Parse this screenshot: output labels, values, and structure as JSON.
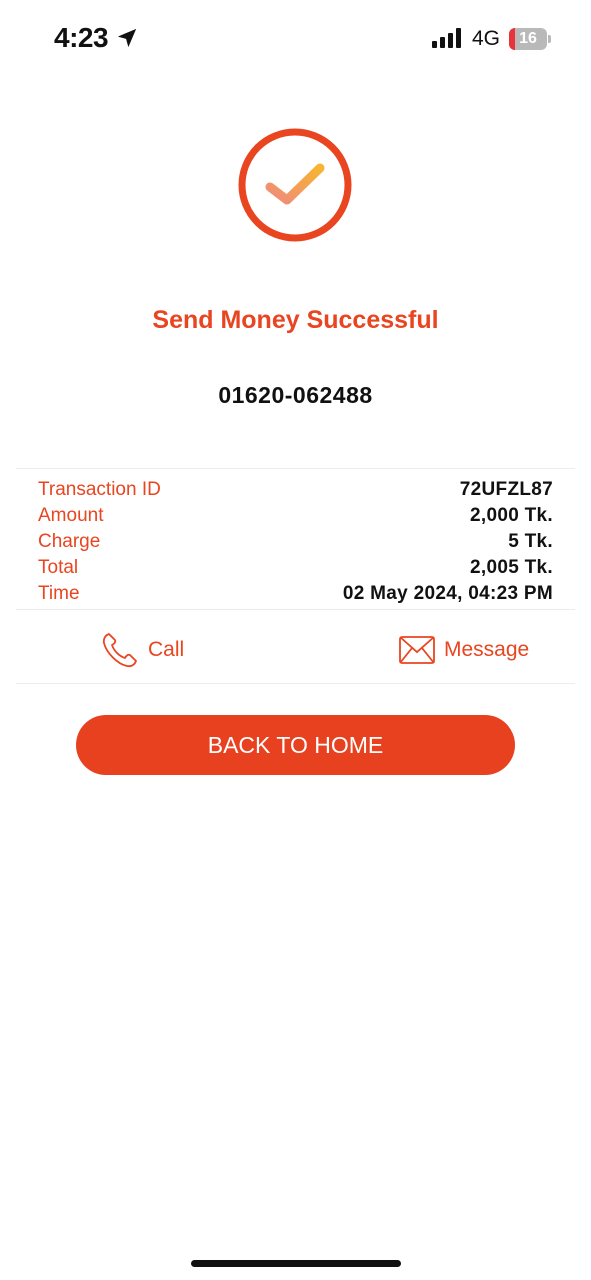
{
  "status_bar": {
    "time": "4:23",
    "network": "4G",
    "battery_level": "16",
    "battery_fraction": 0.16,
    "icons": [
      "location-arrow-icon",
      "signal-bars-icon",
      "battery-icon"
    ]
  },
  "success": {
    "icon": "checkmark-circle-icon",
    "title": "Send Money Successful",
    "recipient": "01620-062488"
  },
  "details": [
    {
      "label": "Transaction ID",
      "value": "72UFZL87"
    },
    {
      "label": "Amount",
      "value": "2,000 Tk."
    },
    {
      "label": "Charge",
      "value": "5 Tk."
    },
    {
      "label": "Total",
      "value": "2,005 Tk."
    },
    {
      "label": "Time",
      "value": "02 May 2024, 04:23 PM"
    }
  ],
  "actions": {
    "call_label": "Call",
    "call_icon": "phone-icon",
    "message_label": "Message",
    "message_icon": "envelope-icon"
  },
  "button": {
    "label": "BACK TO HOME"
  },
  "colors": {
    "accent": "#e84520",
    "button": "#e8411f",
    "text": "#111111",
    "battery_low": "#e8333a"
  }
}
